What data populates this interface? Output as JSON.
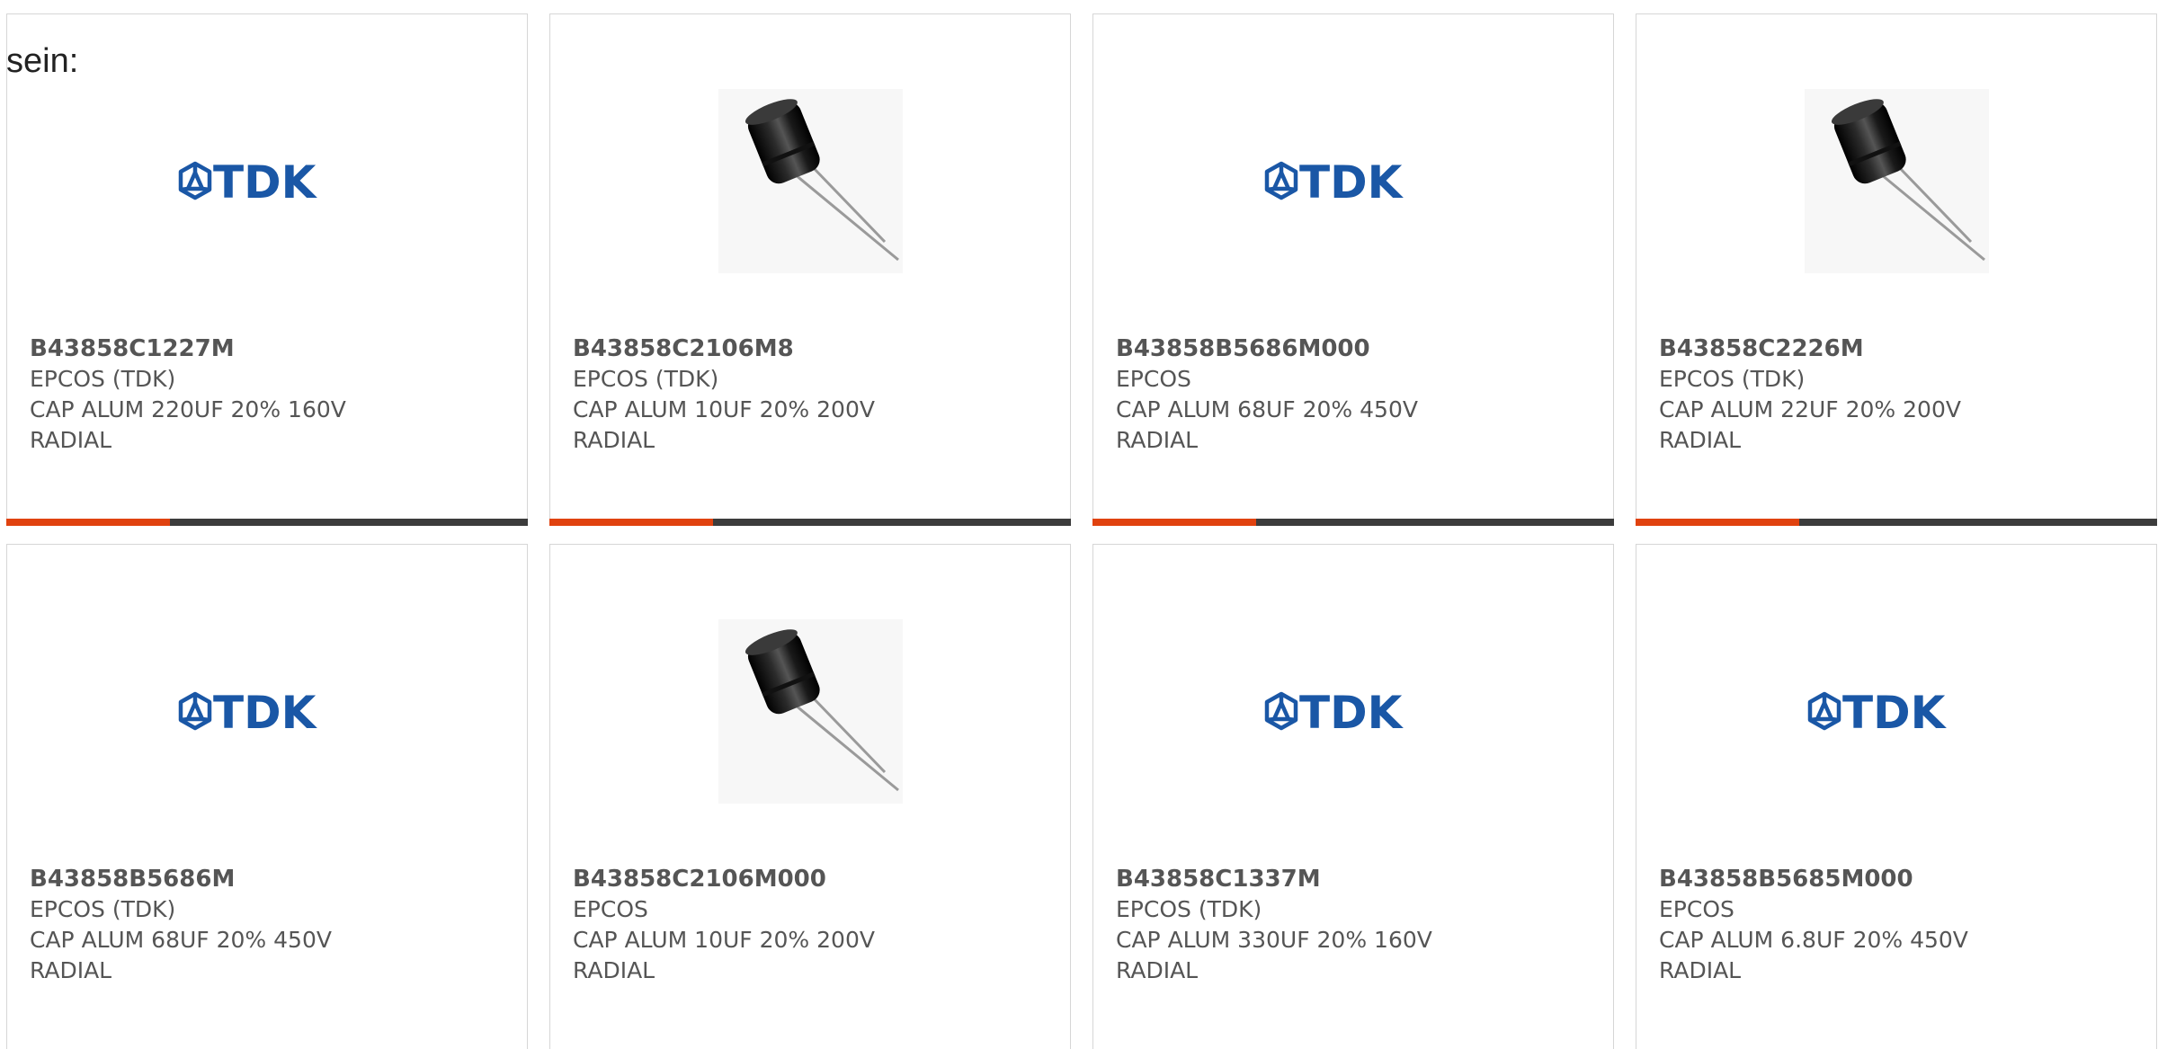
{
  "intro_text": "sein:",
  "colors": {
    "accent": "#e0420f",
    "bar_dark": "#3c3c3c",
    "tdk_blue": "#1a57a6",
    "text": "#555555"
  },
  "products": [
    {
      "part": "B43858C1227M",
      "maker": "EPCOS (TDK)",
      "desc": "CAP ALUM 220UF 20% 160V",
      "pkg": "RADIAL",
      "image": "tdk-logo"
    },
    {
      "part": "B43858C2106M8",
      "maker": "EPCOS (TDK)",
      "desc": "CAP ALUM 10UF 20% 200V",
      "pkg": "RADIAL",
      "image": "capacitor-photo"
    },
    {
      "part": "B43858B5686M000",
      "maker": "EPCOS",
      "desc": "CAP ALUM 68UF 20% 450V",
      "pkg": "RADIAL",
      "image": "tdk-logo"
    },
    {
      "part": "B43858C2226M",
      "maker": "EPCOS (TDK)",
      "desc": "CAP ALUM 22UF 20% 200V",
      "pkg": "RADIAL",
      "image": "capacitor-photo"
    },
    {
      "part": "B43858B5686M",
      "maker": "EPCOS (TDK)",
      "desc": "CAP ALUM 68UF 20% 450V",
      "pkg": "RADIAL",
      "image": "tdk-logo"
    },
    {
      "part": "B43858C2106M000",
      "maker": "EPCOS",
      "desc": "CAP ALUM 10UF 20% 200V",
      "pkg": "RADIAL",
      "image": "capacitor-photo"
    },
    {
      "part": "B43858C1337M",
      "maker": "EPCOS (TDK)",
      "desc": "CAP ALUM 330UF 20% 160V",
      "pkg": "RADIAL",
      "image": "tdk-logo"
    },
    {
      "part": "B43858B5685M000",
      "maker": "EPCOS",
      "desc": "CAP ALUM 6.8UF 20% 450V",
      "pkg": "RADIAL",
      "image": "tdk-logo"
    }
  ],
  "tdk_logo_text": "TDK"
}
